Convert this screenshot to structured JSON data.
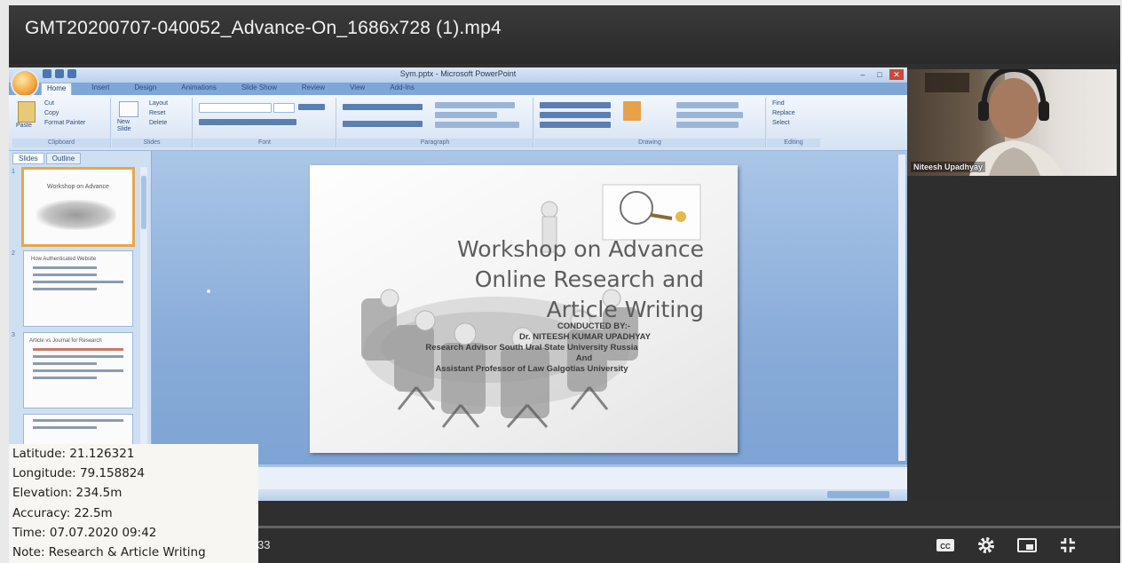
{
  "video": {
    "title": "GMT20200707-040052_Advance-On_1686x728 (1).mp4",
    "time_partial": "33",
    "progress": 0
  },
  "ppt": {
    "window_title": "Sym.pptx - Microsoft PowerPoint",
    "ribbon_tabs": [
      "Home",
      "Insert",
      "Design",
      "Animations",
      "Slide Show",
      "Review",
      "View",
      "Add-Ins"
    ],
    "ribbon_groups": [
      "Clipboard",
      "Slides",
      "Font",
      "Paragraph",
      "Drawing",
      "Editing"
    ],
    "ribbon_labels": {
      "paste": "Paste",
      "cut": "Cut",
      "copy": "Copy",
      "format_painter": "Format Painter",
      "new_slide": "New Slide",
      "layout": "Layout",
      "reset": "Reset",
      "delete": "Delete",
      "find": "Find",
      "replace": "Replace",
      "select": "Select"
    },
    "panel_tabs": [
      "Slides",
      "Outline"
    ],
    "thumbnails": [
      {
        "number": "1",
        "title": "Workshop on Advance"
      },
      {
        "number": "2",
        "title": "How Authenticated Website"
      },
      {
        "number": "3",
        "title": "Article vs Journal for Research"
      },
      {
        "number": "4",
        "title": ""
      }
    ],
    "slide": {
      "title_line1": "Workshop on Advance",
      "title_line2": "Online Research and",
      "title_line3": "Article Writing",
      "conducted_by": "CONDUCTED BY:-",
      "presenter": "Dr. NITEESH KUMAR UPADHYAY",
      "role1": "Research Advisor South Ural State University Russia",
      "and": "And",
      "role2": "Assistant Professor of Law Galgotias University"
    }
  },
  "webcam": {
    "participant_name": "Niteesh Upadhyay"
  },
  "geo_overlay": {
    "latitude": "Latitude: 21.126321",
    "longitude": "Longitude: 79.158824",
    "elevation": "Elevation: 234.5m",
    "accuracy": "Accuracy: 22.5m",
    "time": "Time: 07.07.2020 09:42",
    "note": "Note: Research & Article Writing"
  },
  "controls": {
    "icons": [
      "closed-captions-icon",
      "settings-gear-icon",
      "miniplayer-icon",
      "exit-fullscreen-icon"
    ]
  }
}
